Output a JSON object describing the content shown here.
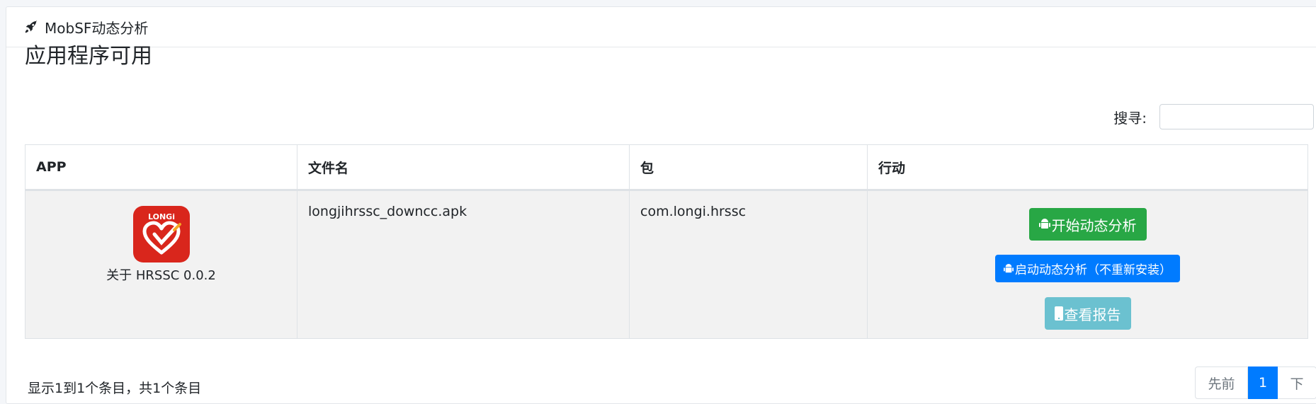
{
  "header": {
    "title": "MobSF动态分析",
    "icon": "rocket-icon"
  },
  "main": {
    "title": "应用程序可用"
  },
  "search": {
    "label": "搜寻:",
    "value": "",
    "placeholder": ""
  },
  "table": {
    "columns": [
      "APP",
      "文件名",
      "包",
      "行动"
    ],
    "rows": [
      {
        "app_icon": "longi-app-icon",
        "app_icon_text": "LONGi",
        "app_name": "关于 HRSSC 0.0.2",
        "file_name": "longjihrssc_downcc.apk",
        "package": "com.longi.hrssc",
        "actions": {
          "start": "开始动态分析",
          "start_no_reinstall": "启动动态分析（不重新安装）",
          "view_report": "查看报告"
        }
      }
    ]
  },
  "footer": {
    "info": "显示1到1个条目，共1个条目",
    "pagination": {
      "prev": "先前",
      "current": "1",
      "next": "下"
    }
  },
  "colors": {
    "success": "#28a745",
    "primary": "#007bff",
    "info": "#6bc1d0",
    "app_icon_bg": "#d9261c"
  }
}
